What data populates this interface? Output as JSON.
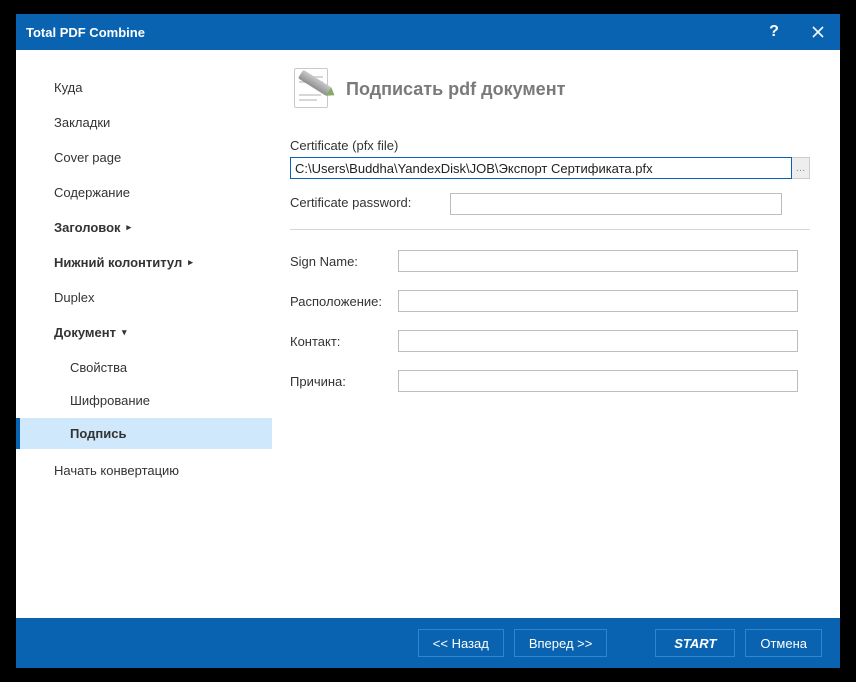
{
  "title": "Total PDF Combine",
  "sidebar": {
    "items": [
      {
        "label": "Куда"
      },
      {
        "label": "Закладки"
      },
      {
        "label": "Cover page"
      },
      {
        "label": "Содержание"
      },
      {
        "label": "Заголовок",
        "bold": true,
        "arrow": "▸"
      },
      {
        "label": "Нижний колонтитул",
        "bold": true,
        "arrow": "▸"
      },
      {
        "label": "Duplex"
      },
      {
        "label": "Документ",
        "bold": true,
        "arrow": "▾"
      }
    ],
    "subitems": [
      {
        "label": "Свойства"
      },
      {
        "label": "Шифрование"
      },
      {
        "label": "Подпись",
        "selected": true
      }
    ],
    "last": {
      "label": "Начать конвертацию"
    }
  },
  "main": {
    "heading": "Подписать pdf документ",
    "cert_label": "Certificate (pfx file)",
    "cert_value": "C:\\Users\\Buddha\\YandexDisk\\JOB\\Экспорт Сертификата.pfx",
    "cert_pw_label": "Certificate password:",
    "cert_pw_value": "",
    "fields": [
      {
        "label": "Sign Name:",
        "value": ""
      },
      {
        "label": "Расположение:",
        "value": ""
      },
      {
        "label": "Контакт:",
        "value": ""
      },
      {
        "label": "Причина:",
        "value": ""
      }
    ]
  },
  "footer": {
    "back": "<<  Назад",
    "next": "Вперед  >>",
    "start": "START",
    "cancel": "Отмена"
  }
}
